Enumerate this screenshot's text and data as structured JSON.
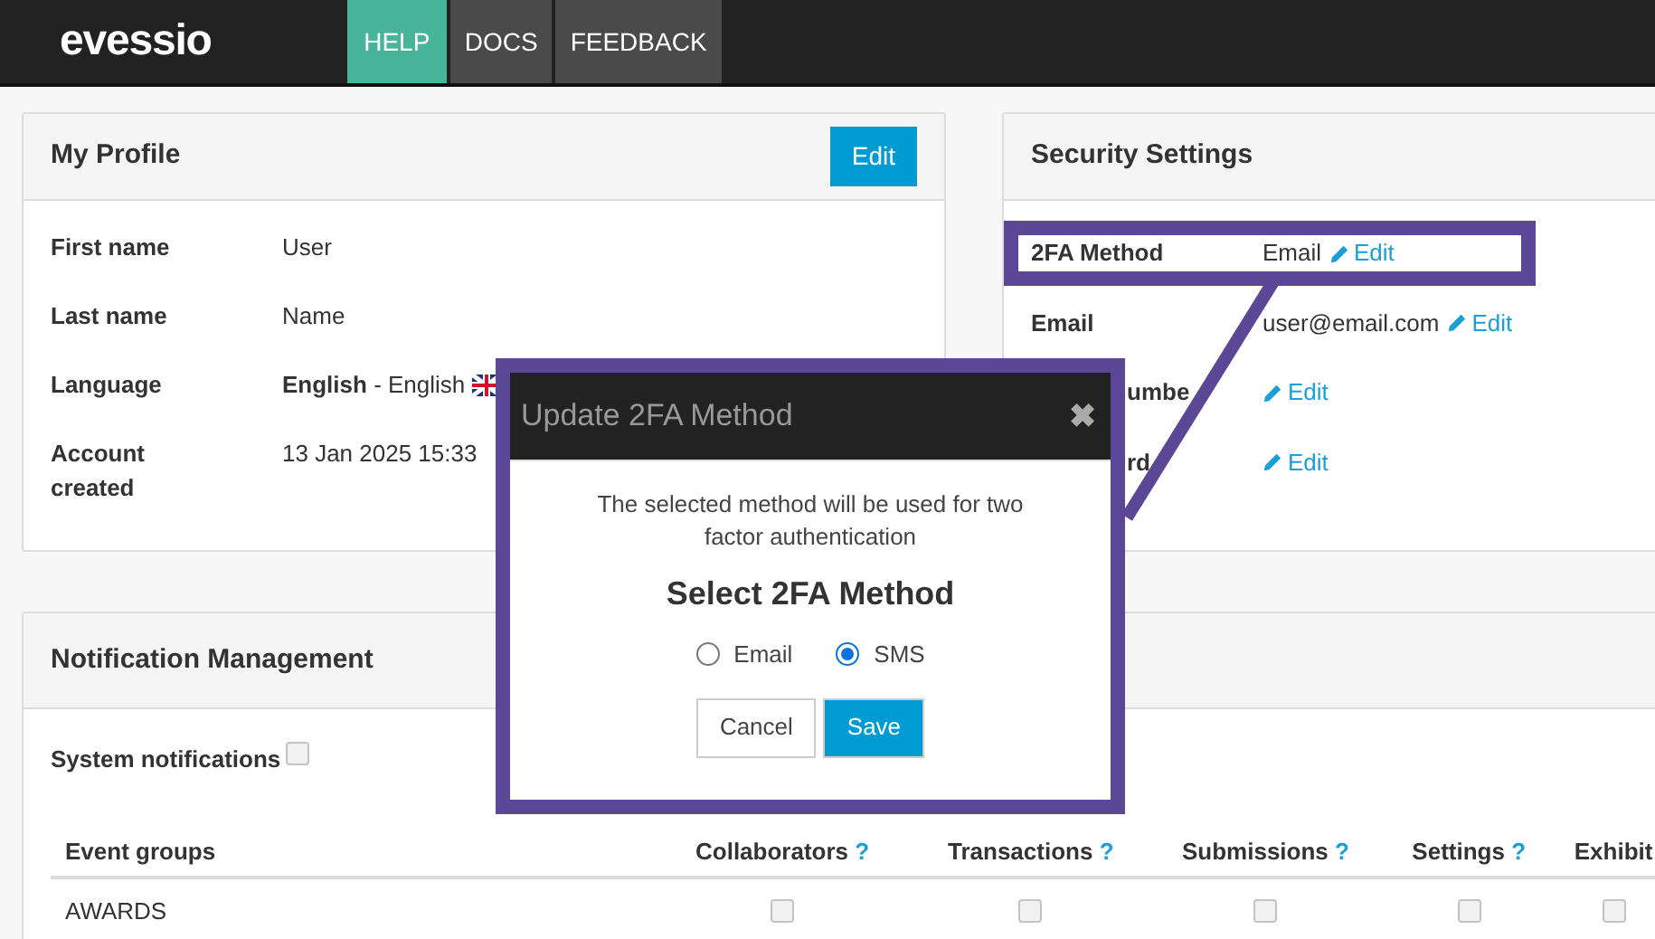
{
  "nav": {
    "logo": "evessio",
    "tabs": [
      {
        "label": "HELP",
        "selected": true
      },
      {
        "label": "DOCS",
        "selected": false
      },
      {
        "label": "FEEDBACK",
        "selected": false
      }
    ]
  },
  "profile": {
    "title": "My Profile",
    "edit_button": "Edit",
    "rows": [
      {
        "label": "First name",
        "value": "User"
      },
      {
        "label": "Last name",
        "value": "Name"
      },
      {
        "label": "Language",
        "value": "**English** - English",
        "flag": true
      },
      {
        "label": "Account created",
        "value": "13 Jan 2025 15:33"
      }
    ]
  },
  "security": {
    "title": "Security Settings",
    "rows": [
      {
        "label": "2FA Method",
        "value": "Email",
        "link": "Edit",
        "highlighted": true,
        "clipped": false
      },
      {
        "label": "Email",
        "value": "user@email.com",
        "link": "Edit",
        "highlighted": false,
        "clipped": false
      },
      {
        "label": "umbe",
        "link": "Edit",
        "highlighted": false,
        "clipped": true
      },
      {
        "label": "rd",
        "link": "Edit",
        "highlighted": false,
        "clipped": true
      }
    ]
  },
  "notifications": {
    "title": "Notification Management",
    "system": {
      "label": "System notifications",
      "checked": false
    },
    "columns": [
      {
        "label": "Event groups"
      },
      {
        "label": "Collaborators",
        "help": "?"
      },
      {
        "label": "Transactions",
        "help": "?"
      },
      {
        "label": "Submissions",
        "help": "?"
      },
      {
        "label": "Settings",
        "help": "?"
      },
      {
        "label": "Exhibit"
      }
    ],
    "rows": [
      {
        "name": "AWARDS",
        "checks": [
          false,
          false,
          false,
          false,
          false
        ]
      }
    ]
  },
  "modal": {
    "title": "Update 2FA Method",
    "close": "✖",
    "message": "The selected method will be used for two factor authentication",
    "heading": "Select 2FA Method",
    "options": [
      {
        "label": "Email",
        "selected": false
      },
      {
        "label": "SMS",
        "selected": true
      }
    ],
    "cancel": "Cancel",
    "save": "Save"
  }
}
